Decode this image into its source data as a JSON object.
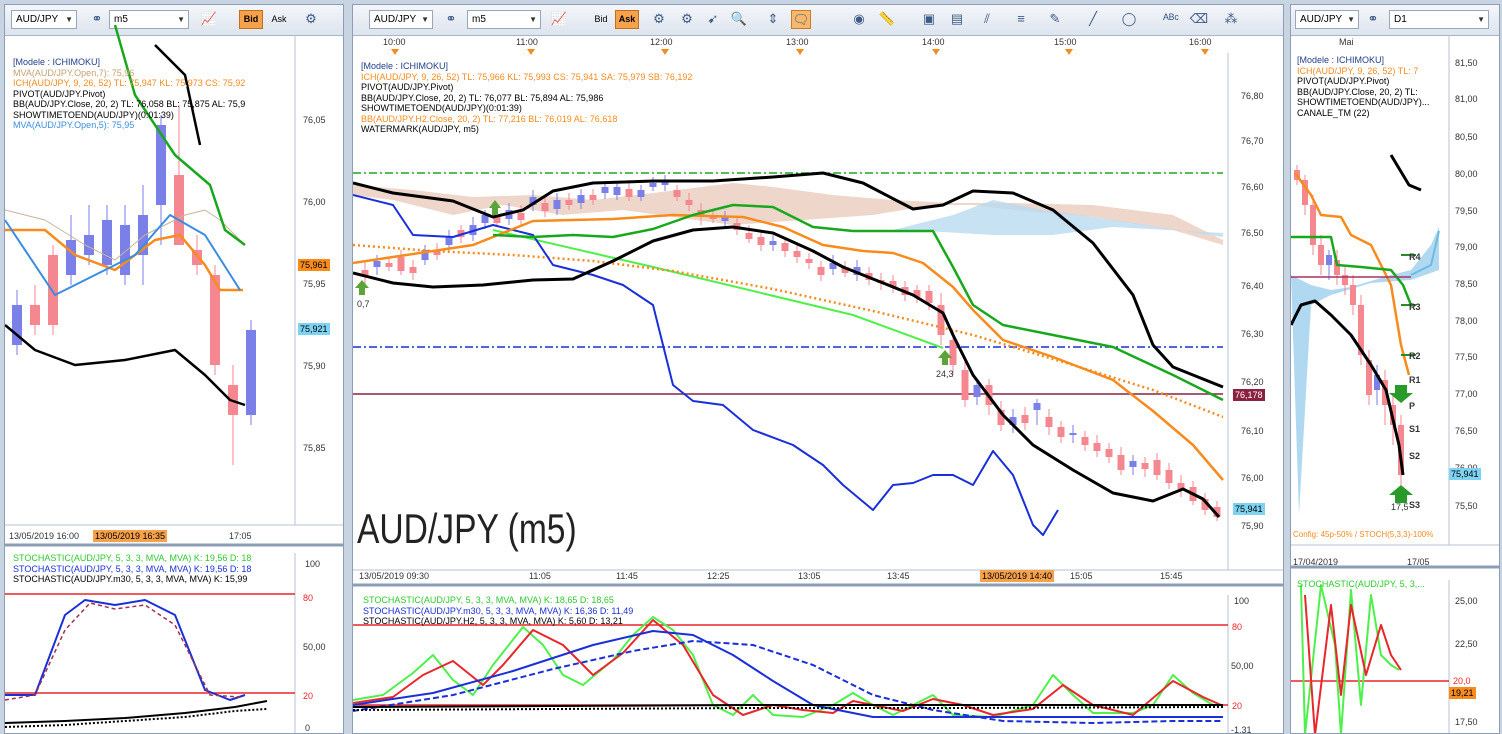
{
  "colors": {
    "up": "#7b7fe8",
    "down": "#f4878f",
    "orange": "#f78b1e",
    "green": "#19a81d",
    "black": "#000",
    "blue": "#1a2fd8",
    "lime": "#4ef04a",
    "red": "#e8262b",
    "accent": "#f6a14b"
  },
  "left": {
    "symbol": "AUD/JPY",
    "period": "m5",
    "bid": "Bid",
    "ask": "Ask",
    "legend": [
      "[Modele : ICHIMOKU]",
      "MVA(AUD/JPY.Open,7): 75,96",
      "ICH(AUD/JPY, 9, 26, 52)  TL: 75,947  KL: 75,973  CS: 75,92",
      "PIVOT(AUD/JPY.Pivot)",
      "BB(AUD/JPY.Close, 20, 2)  TL: 76,058  BL: 75,875  AL: 75,9",
      "SHOWTIMETOEND(AUD/JPY)(0:01:39)",
      "MVA(AUD/JPY.Open,5): 75,95"
    ],
    "y_ticks": [
      "76,05",
      "76,00",
      "75,95",
      "75,90",
      "75,85"
    ],
    "tag_orange": "75,961",
    "tag_blue": "75,921",
    "x_labels": [
      "13/05/2019 16:00",
      "17:05"
    ],
    "time_cursor": "13/05/2019 16:35",
    "stoch_legend": [
      "STOCHASTIC(AUD/JPY, 5, 3, 3, MVA, MVA)  K: 19,56  D: 18",
      "STOCHASTIC(AUD/JPY, 5, 3, 3, MVA, MVA)  K: 19,56  D: 18",
      "STOCHASTIC(AUD/JPY.m30, 5, 3, 3, MVA, MVA)  K: 15,99"
    ],
    "stoch_ticks": [
      "100",
      "80",
      "50,00",
      "20",
      "0"
    ]
  },
  "main": {
    "symbol": "AUD/JPY",
    "period": "m5",
    "bid": "Bid",
    "ask": "Ask",
    "top_times": [
      "10:00",
      "11:00",
      "12:00",
      "13:00",
      "14:00",
      "15:00",
      "16:00"
    ],
    "legend": [
      "[Modele : ICHIMOKU]",
      "ICH(AUD/JPY, 9, 26, 52)  TL: 75,966  KL: 75,993  CS: 75,941  SA: 75,979  SB: 76,192",
      "PIVOT(AUD/JPY.Pivot)",
      "BB(AUD/JPY.Close, 20, 2)  TL: 76,077  BL: 75,894  AL: 75,986",
      "SHOWTIMETOEND(AUD/JPY)(0:01:39)",
      "BB(AUD/JPY.H2.Close, 20, 2)  TL: 77,216  BL: 76,019  AL: 76,618",
      "WATERMARK(AUD/JPY, m5)"
    ],
    "y_ticks": [
      "76,80",
      "76,70",
      "76,60",
      "76,50",
      "76,40",
      "76,30",
      "76,20",
      "76,10",
      "76,00",
      "75,90"
    ],
    "tag_maroon": "76,178",
    "tag_blue": "75,941",
    "watermark": "AUD/JPY (m5)",
    "marker1": "0,7",
    "marker2": "24,3",
    "x_labels": [
      "13/05/2019 09:30",
      "11:05",
      "11:45",
      "12:25",
      "13:05",
      "13:45",
      "15:05",
      "15:45"
    ],
    "time_cursor": "13/05/2019 14:40",
    "stoch_legend": [
      "STOCHASTIC(AUD/JPY, 5, 3, 3, MVA, MVA)  K: 18,65  D: 18,65",
      "STOCHASTIC(AUD/JPY.m30, 5, 3, 3, MVA, MVA)  K: 16,36  D: 11,49",
      "STOCHASTIC(AUD/JPY.H2, 5, 3, 3, MVA, MVA)  K: 5,60  D: 13,21"
    ],
    "stoch_ticks": [
      "100",
      "80",
      "50,00",
      "20",
      "-1,31"
    ]
  },
  "right": {
    "symbol": "AUD/JPY",
    "period": "D1",
    "month": "Mai",
    "legend": [
      "[Modele : ICHIMOKU]",
      "ICH(AUD/JPY, 9, 26, 52)  TL: 7",
      "PIVOT(AUD/JPY.Pivot)",
      "BB(AUD/JPY.Close, 20, 2)  TL:",
      "SHOWTIMETOEND(AUD/JPY)...",
      "CANALE_TM (22)"
    ],
    "y_ticks": [
      "81,50",
      "81,00",
      "80,50",
      "80,00",
      "79,50",
      "79,00",
      "78,50",
      "78,00",
      "77,50",
      "77,00",
      "76,50",
      "76,00",
      "75,50"
    ],
    "pivots": [
      "R4",
      "R3",
      "R2",
      "R1",
      "P",
      "S1",
      "S2",
      "S3"
    ],
    "tag_blue": "75,941",
    "marker": "17,5",
    "config": "Config: 45p-50% / STOCH(5,3,3)-100%",
    "x_labels": [
      "17/04/2019",
      "17/05"
    ],
    "stoch_legend": [
      "STOCHASTIC(AUD/JPY, 5, 3,..."
    ],
    "stoch_ticks": [
      "25,00",
      "22,50",
      "20,0",
      "19,21",
      "17,50"
    ]
  }
}
